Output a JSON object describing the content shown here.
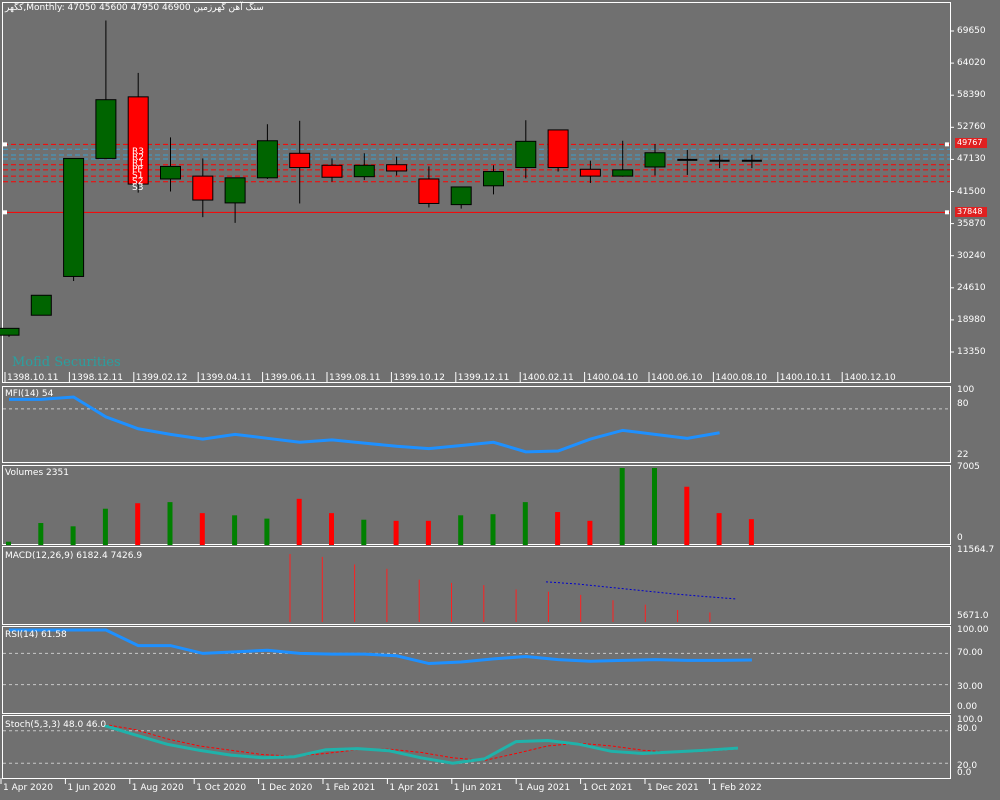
{
  "header": {
    "symbol": "کگهر,Monthly:",
    "ohlc": "47050 45600 47950 46900",
    "name": "سنگ آهن گهرزمین"
  },
  "watermark": "Mofid Securities",
  "price_axis": [
    "69650",
    "64020",
    "58390",
    "52760",
    "47130",
    "41500",
    "35870",
    "30240",
    "24610",
    "18980",
    "13350"
  ],
  "price_tags": {
    "upper": "49767",
    "lower": "37848"
  },
  "pivot_labels": [
    "R3",
    "R2",
    "R1",
    "PP",
    "S1",
    "S2",
    "S3"
  ],
  "date_axis": [
    "1398.10.11",
    "1398.12.11",
    "1399.02.12",
    "1399.04.11",
    "1399.06.11",
    "1399.08.11",
    "1399.10.12",
    "1399.12.11",
    "1400.02.11",
    "1400.04.10",
    "1400.06.10",
    "1400.08.10",
    "1400.10.11",
    "1400.12.10"
  ],
  "time_axis": [
    "1 Apr 2020",
    "1 Jun 2020",
    "1 Aug 2020",
    "1 Oct 2020",
    "1 Dec 2020",
    "1 Feb 2021",
    "1 Apr 2021",
    "1 Jun 2021",
    "1 Aug 2021",
    "1 Oct 2021",
    "1 Dec 2021",
    "1 Feb 2022"
  ],
  "indicators": {
    "mfi": {
      "label": "MFI(14) 54",
      "axis": [
        "100",
        "80",
        "22"
      ]
    },
    "volumes": {
      "label": "Volumes 2351",
      "axis": [
        "7005",
        "0"
      ]
    },
    "macd": {
      "label": "MACD(12,26,9) 6182.4 7426.9",
      "axis": [
        "11564.7",
        "5671.0"
      ]
    },
    "rsi": {
      "label": "RSI(14) 61.58",
      "axis": [
        "100.00",
        "70.00",
        "30.00",
        "0.00"
      ]
    },
    "stoch": {
      "label": "Stoch(5,3,3) 48.0 46.0",
      "axis": [
        "100.0",
        "80.0",
        "20.0",
        "0.0"
      ]
    }
  },
  "colors": {
    "bg": "#707070",
    "bull": "#006400",
    "bear": "#ff0000",
    "line": "#1e90ff",
    "stoch_main": "#20b2aa",
    "signal": "#ff0000",
    "macd_signal": "#0000cd"
  },
  "chart_data": {
    "type": "candlestick",
    "price_axis": {
      "min": 13350,
      "max": 69650
    },
    "candles": [
      {
        "o": 16300,
        "h": 17500,
        "l": 16000,
        "c": 17500,
        "bull": true
      },
      {
        "o": 19800,
        "h": 23300,
        "l": 19800,
        "c": 23300,
        "bull": true
      },
      {
        "o": 26600,
        "h": 47300,
        "l": 25800,
        "c": 47300,
        "bull": true
      },
      {
        "o": 47300,
        "h": 71500,
        "l": 47300,
        "c": 57600,
        "bull": true
      },
      {
        "o": 58100,
        "h": 62300,
        "l": 41300,
        "c": 42800,
        "bull": false
      },
      {
        "o": 43700,
        "h": 51000,
        "l": 41500,
        "c": 45900,
        "bull": true
      },
      {
        "o": 44200,
        "h": 47300,
        "l": 37000,
        "c": 40000,
        "bull": false
      },
      {
        "o": 39500,
        "h": 43700,
        "l": 36000,
        "c": 43900,
        "bull": true
      },
      {
        "o": 43900,
        "h": 53300,
        "l": 43700,
        "c": 50400,
        "bull": true
      },
      {
        "o": 48200,
        "h": 53900,
        "l": 39400,
        "c": 45700,
        "bull": false
      },
      {
        "o": 46100,
        "h": 47300,
        "l": 43200,
        "c": 44000,
        "bull": false
      },
      {
        "o": 44100,
        "h": 48200,
        "l": 43500,
        "c": 46100,
        "bull": true
      },
      {
        "o": 46200,
        "h": 47600,
        "l": 44300,
        "c": 45100,
        "bull": false
      },
      {
        "o": 43700,
        "h": 45900,
        "l": 38700,
        "c": 39400,
        "bull": false
      },
      {
        "o": 39200,
        "h": 42100,
        "l": 38500,
        "c": 42300,
        "bull": true
      },
      {
        "o": 42500,
        "h": 46100,
        "l": 41000,
        "c": 45000,
        "bull": true
      },
      {
        "o": 45700,
        "h": 54000,
        "l": 43800,
        "c": 50300,
        "bull": true
      },
      {
        "o": 52300,
        "h": 52300,
        "l": 45000,
        "c": 45700,
        "bull": false
      },
      {
        "o": 45400,
        "h": 46900,
        "l": 43000,
        "c": 44200,
        "bull": false
      },
      {
        "o": 44200,
        "h": 50400,
        "l": 44100,
        "c": 45300,
        "bull": true
      },
      {
        "o": 45800,
        "h": 49800,
        "l": 44300,
        "c": 48300,
        "bull": true
      },
      {
        "o": 48300,
        "h": 48800,
        "l": 44400,
        "c": 47050,
        "bull": false
      },
      {
        "o": 47050,
        "h": 47950,
        "l": 45600,
        "c": 46900,
        "bull": false
      },
      {
        "o": 47050,
        "h": 47950,
        "l": 45600,
        "c": 46900,
        "bull": false
      }
    ],
    "volume": [
      300,
      2000,
      1700,
      3300,
      3800,
      3900,
      2900,
      2700,
      2400,
      4200,
      2900,
      2300,
      2200,
      2200,
      2700,
      2800,
      3900,
      3000,
      2200,
      7005,
      7005,
      5300,
      2900,
      2351
    ],
    "mfi": [
      92,
      92,
      95,
      70,
      55,
      48,
      42,
      48,
      43,
      38,
      41,
      37,
      33,
      30,
      34,
      38,
      26,
      27,
      42,
      53,
      48,
      43,
      50
    ],
    "macd_hist": [
      11564,
      11300,
      10600,
      10200,
      9200,
      8900,
      8700,
      8300,
      8100,
      7800,
      7300,
      6900,
      6400,
      6182
    ],
    "macd_signal_line": [
      9000,
      8800,
      8500,
      8200,
      7900,
      7650,
      7426.9
    ],
    "rsi": [
      100,
      100,
      100,
      100,
      80,
      80,
      70,
      72,
      74,
      70,
      69,
      69,
      67,
      57,
      59,
      63,
      66,
      62,
      60,
      61,
      62,
      61,
      61,
      61.58
    ],
    "stoch_main": [
      90,
      72,
      55,
      44,
      35,
      30,
      32,
      45,
      47,
      43,
      30,
      20,
      28,
      60,
      62,
      55,
      42,
      38,
      41,
      44,
      48
    ],
    "stoch_signal": [
      92,
      82,
      65,
      52,
      44,
      36,
      33,
      38,
      45,
      46,
      40,
      30,
      25,
      38,
      52,
      57,
      52,
      44,
      40,
      42,
      46
    ]
  }
}
